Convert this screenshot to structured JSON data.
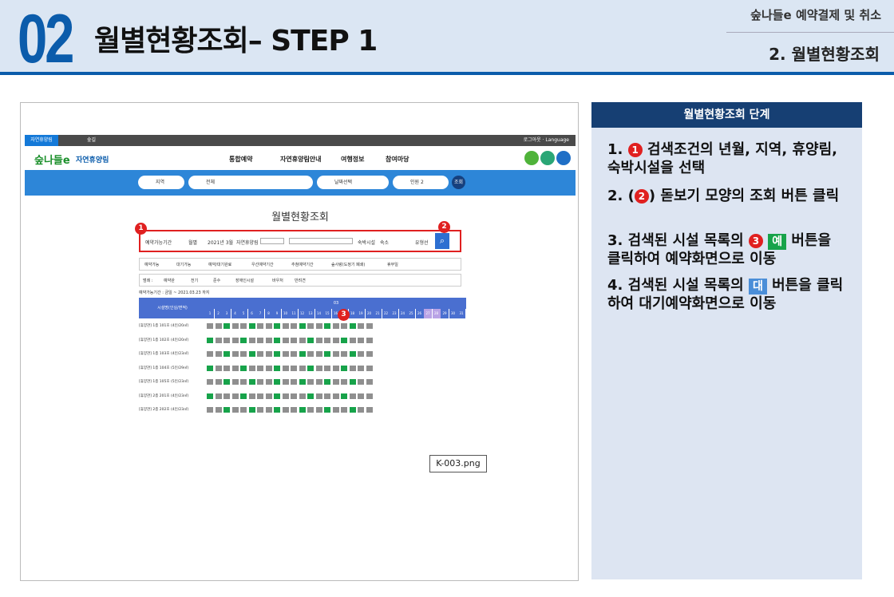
{
  "header": {
    "number": "02",
    "title": "월별현황조회– STEP 1",
    "top_right": "숲나들e 예약결제 및 취소",
    "subtitle": "2. 월별현황조회"
  },
  "screenshot": {
    "topbar": {
      "tab1": "자연휴양림",
      "tab2": "숲길",
      "right": "로그아웃 · Language"
    },
    "nav": {
      "logo": "숲나들e",
      "logo_sub": "자연휴양림",
      "menu": [
        "통합예약",
        "자연휴양림안내",
        "여행정보",
        "참여마당"
      ]
    },
    "search_bar": {
      "region": "지역",
      "all": "전체",
      "date": "날짜선택",
      "people_label": "인원",
      "people_count": "2",
      "go": "조회"
    },
    "page_title": "월별현황조회",
    "filter": {
      "opt1": "예약가능기간",
      "opt2": "월별",
      "month": "2021년 3월",
      "forest_label": "자연휴양림",
      "facility_label": "숙박시설",
      "type": "숙소",
      "sort": "유형선",
      "search_icon": "search-icon"
    },
    "legend1": [
      "예약가능",
      "대기가능",
      "예약/대기완료",
      "우선예약기간",
      "추첨예약기간",
      "숲사랑(도정기 폐쇄)",
      "휴무일"
    ],
    "legend2": [
      "범례 :",
      "예약완",
      "전기",
      "준수",
      "장애인시설",
      "바우처",
      "반려견"
    ],
    "info": "예약가능기간 : 금일 ~ 2021.03.23 까지",
    "grid_header": "시설명(인실/면적)",
    "month_label": "03",
    "rows": [
      "[휴양관] 1층 101호 (4인/20㎡)",
      "[휴양관] 1층 102호 (4인/20㎡)",
      "[휴양관] 1층 103호 (4인/23㎡)",
      "[휴양관] 1층 104호 (5인/29㎡)",
      "[휴양관] 1층 105호 (5인/23㎡)",
      "[휴양관] 2층 201호 (4인/23㎡)",
      "[휴양관] 2층 202호 (4인/23㎡)"
    ],
    "caption": "K-003.png"
  },
  "markers": [
    "1",
    "2",
    "3"
  ],
  "panel": {
    "title": "월별현황조회 단계",
    "steps": [
      {
        "num": "1.",
        "text": "검색조건의 년월, 지역, 휴양림, 숙박시설을 선택"
      },
      {
        "num": "2.",
        "pre": "(",
        "post": ") 돋보기 모양의 조회 버튼 클릭"
      },
      {
        "num": "3.",
        "pre": "검색된 시설 목록의",
        "badge": "예",
        "post": "버튼을 클릭하여 예약화면으로 이동"
      },
      {
        "num": "4.",
        "pre": "검색된 시설 목록의",
        "badge": "대",
        "post": "버튼을 클릭하여 대기예약화면으로 이동"
      }
    ]
  },
  "colors": {
    "accent": "#0b5cab",
    "panel_header": "#163f73",
    "marker": "#e02020",
    "reserve": "#17a34a",
    "wait": "#4a8ed8"
  }
}
